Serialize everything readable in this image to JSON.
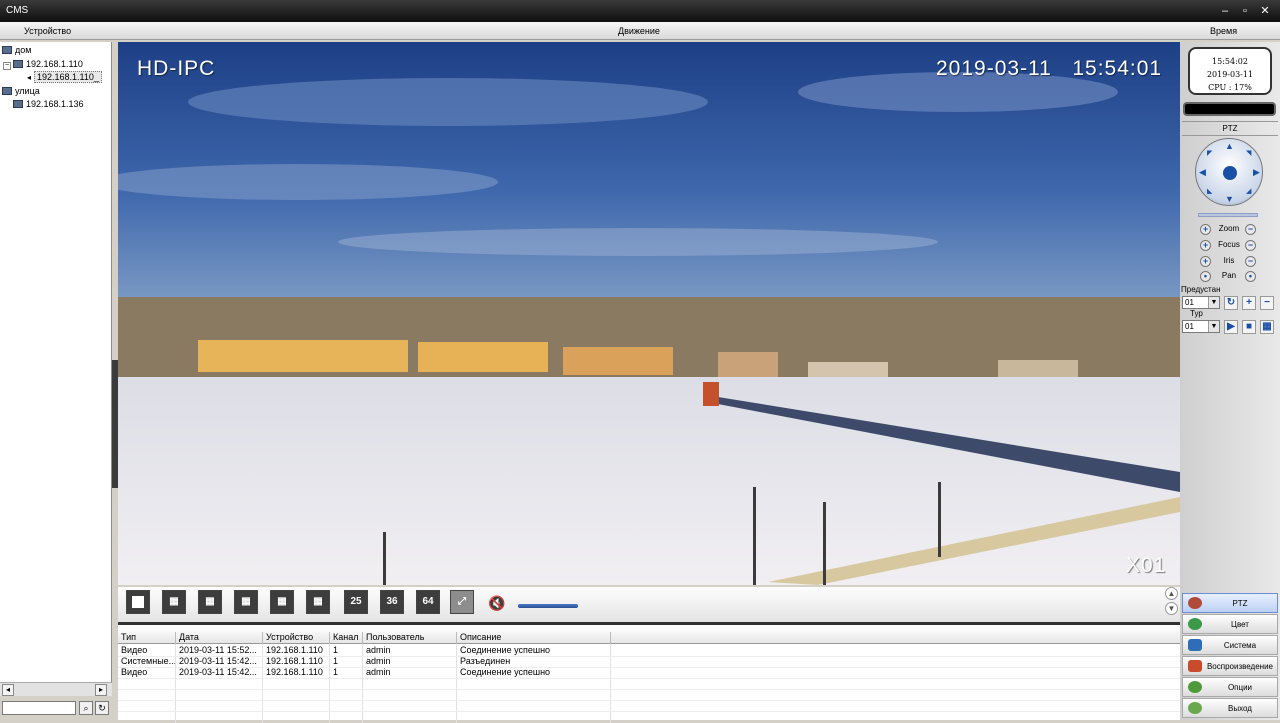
{
  "window": {
    "title": "CMS"
  },
  "menu": {
    "left": "Устройство",
    "center": "Движение",
    "right": "Время"
  },
  "tree": {
    "groups": [
      {
        "label": "дом",
        "devices": [
          "192.168.1.110"
        ],
        "channels": [
          "192.168.1.110_"
        ]
      },
      {
        "label": "улица",
        "devices": [
          "192.168.1.136"
        ]
      }
    ]
  },
  "video": {
    "osd_name": "HD-IPC",
    "osd_datetime": "2019-03-11   15:54:01",
    "osd_channel": "X01"
  },
  "toolbar": {
    "layout_25": "25",
    "layout_36": "36",
    "layout_64": "64",
    "volume_level": 0.6
  },
  "log": {
    "columns": [
      "Тип",
      "Дата",
      "Устройство",
      "Канал",
      "Пользователь",
      "Описание"
    ],
    "rows": [
      [
        "Видео",
        "2019-03-11 15:52...",
        "192.168.1.110",
        "1",
        "admin",
        "Соединение успешно"
      ],
      [
        "Системные...",
        "2019-03-11 15:42...",
        "192.168.1.110",
        "1",
        "admin",
        "Разъединен"
      ],
      [
        "Видео",
        "2019-03-11 15:42...",
        "192.168.1.110",
        "1",
        "admin",
        "Соединение успешно"
      ]
    ]
  },
  "status": {
    "time": "15:54:02",
    "date": "2019-03-11",
    "cpu": "CPU : 17%"
  },
  "ptz": {
    "title": "PTZ",
    "controls": [
      "Zoom",
      "Focus",
      "Iris",
      "Pan"
    ],
    "preset_label": "Предустан",
    "preset_value": "01",
    "tour_label": "Тур",
    "tour_value": "01"
  },
  "sidebar": {
    "buttons": [
      "PTZ",
      "Цвет",
      "Система",
      "Воспроизведение",
      "Опции",
      "Выход"
    ]
  }
}
